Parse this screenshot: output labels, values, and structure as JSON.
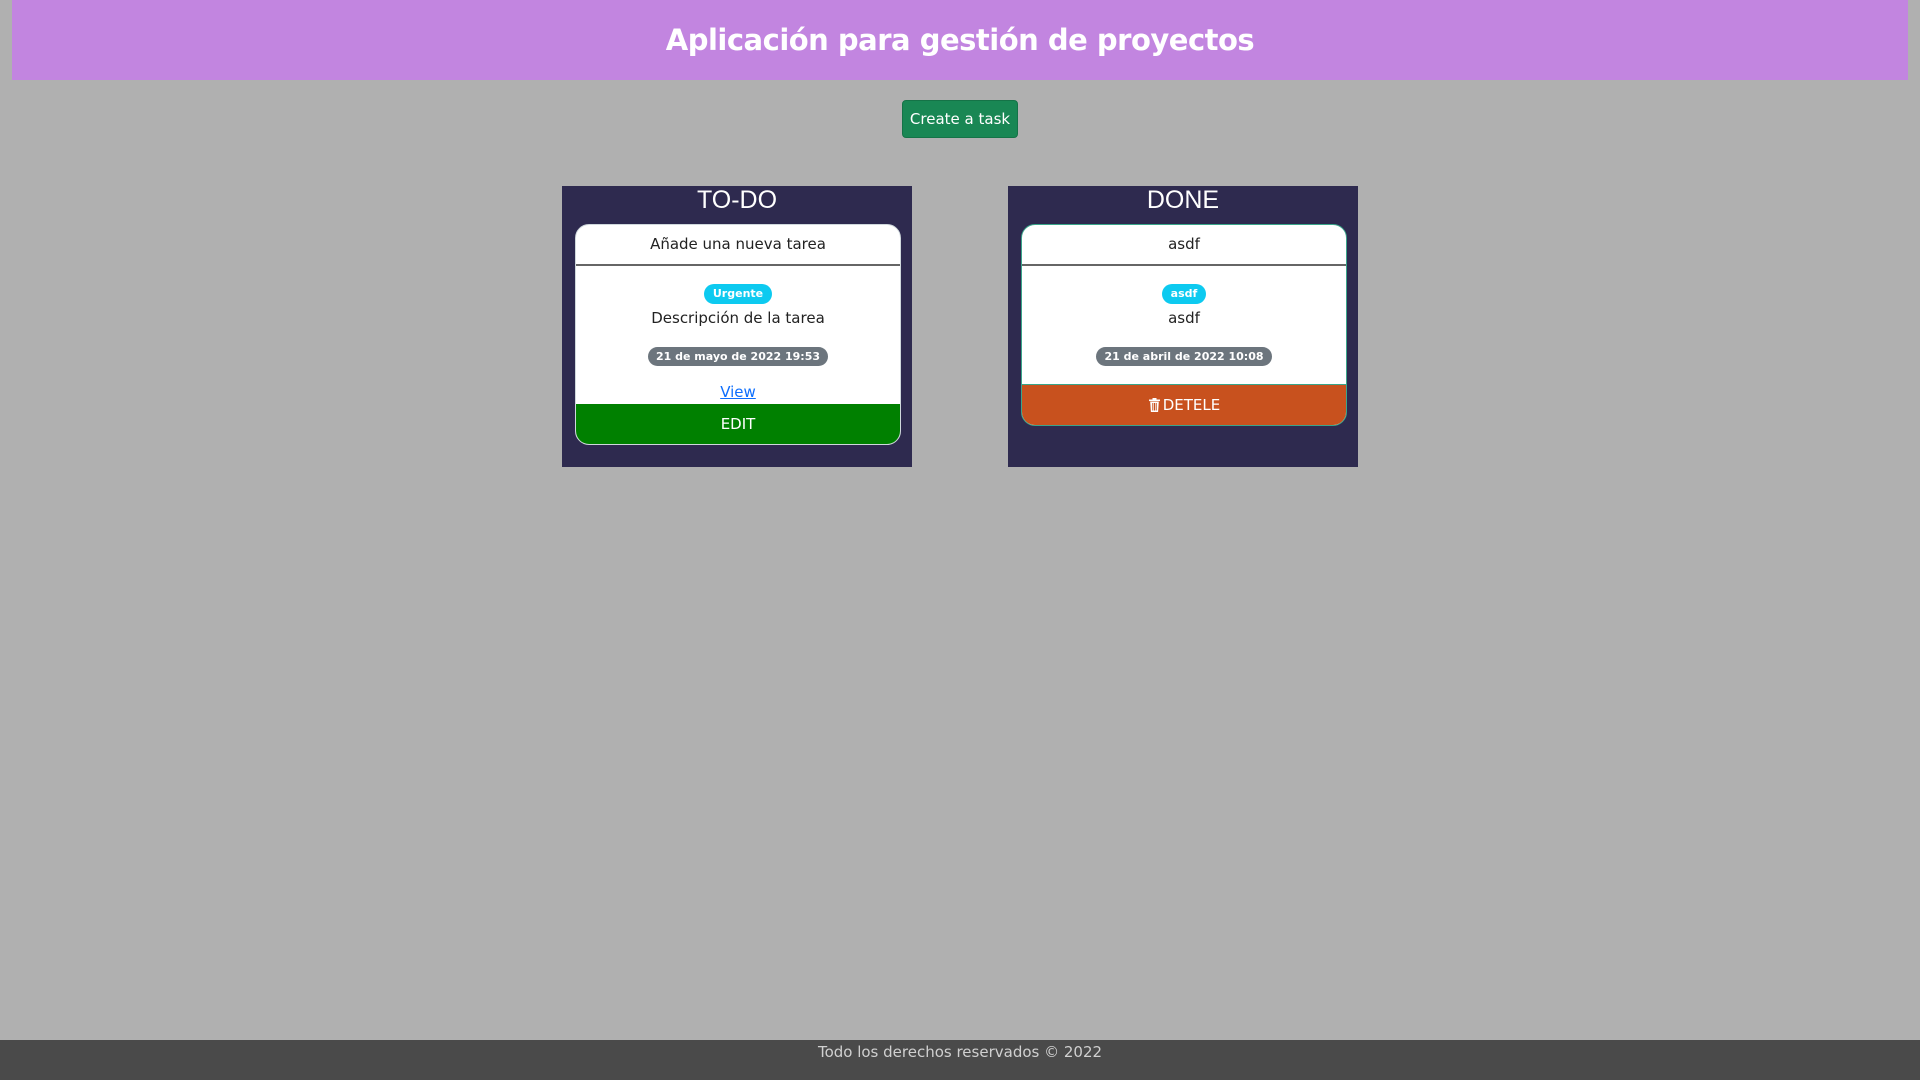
{
  "header": {
    "title": "Aplicación para gestión de proyectos"
  },
  "toolbar": {
    "create_label": "Create a task"
  },
  "columns": [
    {
      "title": "TO-DO",
      "card": {
        "title": "Añade una nueva tarea",
        "tag": "Urgente",
        "description": "Descripción de la tarea",
        "date": "21 de mayo de 2022 19:53",
        "view_label": "View",
        "action_label": "EDIT"
      }
    },
    {
      "title": "DONE",
      "card": {
        "title": "asdf",
        "tag": "asdf",
        "description": "asdf",
        "date": "21 de abril de 2022 10:08",
        "action_label": "DETELE",
        "action_icon": "trash-icon"
      }
    }
  ],
  "footer": {
    "text": "Todo los derechos reservados © 2022"
  },
  "colors": {
    "header_bg": "#c285e0",
    "create_button": "#198754",
    "column_bg": "#2e2a4f",
    "tag_badge": "#0dcaf0",
    "date_badge": "#6c757d",
    "edit_button": "#008000",
    "delete_button": "#c8511e",
    "footer_bg": "#4a4a4a"
  }
}
